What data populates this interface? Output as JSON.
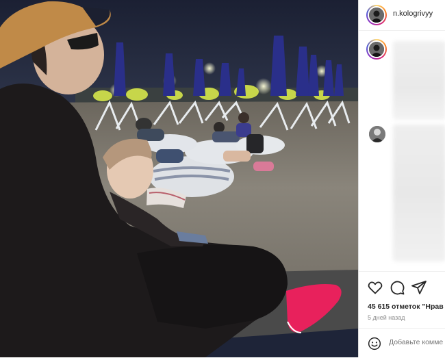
{
  "post": {
    "username": "n.kologrivyy",
    "likes_text": "45 615 отметок \"Нрав",
    "date_text": "5 дней назад",
    "comment_placeholder": "Добавьте комме"
  },
  "icons": {
    "like": "heart-icon",
    "comment": "comment-icon",
    "share": "paper-plane-icon",
    "emoji": "smiley-icon"
  },
  "colors": {
    "text": "#262626",
    "muted": "#8e8e8e",
    "divider": "#efefef",
    "shoe_pink": "#e8215c"
  }
}
